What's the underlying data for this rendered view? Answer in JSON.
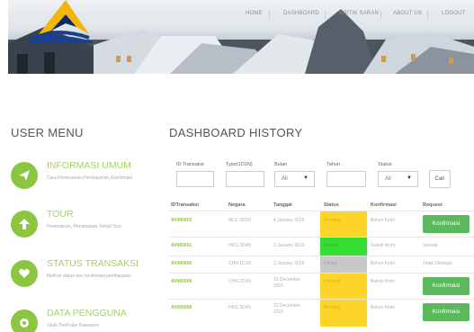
{
  "nav": {
    "items": [
      "HOME",
      "DASHBOARD",
      "KRITIK SARAN",
      "ABOUT US",
      "LOGOUT"
    ]
  },
  "user_menu": {
    "title": "USER MENU",
    "items": [
      {
        "title": "INFORMASI UMUM",
        "desc": "Cara Pemesanan,Pembayaran, Konfirmasi",
        "icon": "send-icon"
      },
      {
        "title": "TOUR",
        "desc": "Pemesanan, Pemesanan, Detail Tour",
        "icon": "arrow-up-icon"
      },
      {
        "title": "STATUS TRANSAKSI",
        "desc": "Melihat status dan konfirmasi pembayaran",
        "icon": "heart-icon"
      },
      {
        "title": "DATA PENGGUNA",
        "desc": "Ubah Profil dan Password",
        "icon": "gear-icon"
      }
    ]
  },
  "dashboard": {
    "title": "DASHBOARD HISTORY",
    "filters": {
      "id_label": "ID Transaksi",
      "type_label": "Type(1D1N)",
      "bulan_label": "Bulan",
      "bulan_value": "All",
      "tahun_label": "Tahun",
      "status_label": "Status",
      "status_value": "All",
      "search_button": "Cari"
    },
    "columns": [
      "IDTransaksi",
      "Negara",
      "Tanggal",
      "Status",
      "Konfirmasi",
      "Request"
    ],
    "rows": [
      {
        "id": "AV000002",
        "negara": "MLD 3D1N",
        "tanggal": "4 January 2016",
        "status": "Pending",
        "konfirmasi": "Belum Kirim",
        "request": "Konfirmasi",
        "request_type": "button"
      },
      {
        "id": "AV000001",
        "negara": "HKG 3D4N",
        "tanggal": "2 January 2016",
        "status": "Sukses",
        "konfirmasi": "Sudah Kirim",
        "request": "Selesai",
        "request_type": "text"
      },
      {
        "id": "AV000000",
        "negara": "CHN 1D1N",
        "tanggal": "2 January 2016",
        "status": "Ditolak",
        "konfirmasi": "Belum Kirim",
        "request": "Tidak Diketujui",
        "request_type": "text"
      },
      {
        "id": "AV000009",
        "negara": "CHN 2D3N",
        "tanggal": "31 December 2015",
        "status": "Pending",
        "konfirmasi": "Belum Kirim",
        "request": "Konfirmasi",
        "request_type": "button"
      },
      {
        "id": "AV000008",
        "negara": "HKG 3D4N",
        "tanggal": "31 December 2015",
        "status": "Pending",
        "konfirmasi": "Belum Kirim",
        "request": "Konfirmasi",
        "request_type": "button"
      }
    ]
  },
  "colors": {
    "accent_green": "#8cc63f",
    "button_green": "#5cb85c",
    "status_pending": "#fdd428",
    "status_sukses": "#33dd33",
    "status_ditolak": "#c8c8c8"
  }
}
